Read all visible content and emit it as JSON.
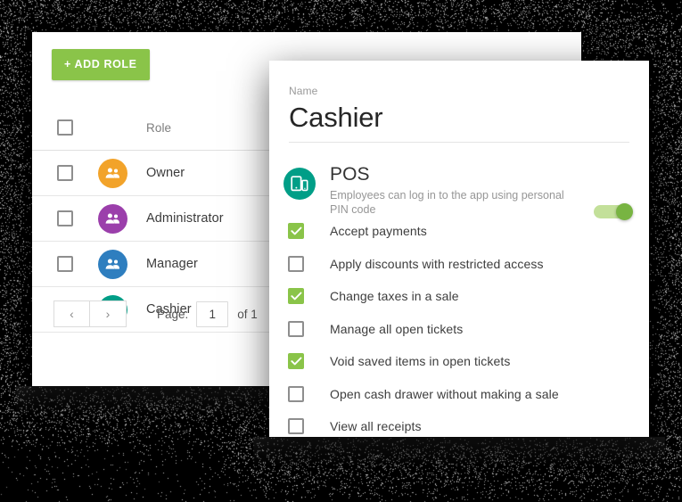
{
  "colors": {
    "accent_green": "#8ac449",
    "toggle_knob": "#78b442",
    "toggle_track": "#c3e09a",
    "teal": "#009e87",
    "backdrop": "#000000",
    "card": "#ffffff"
  },
  "roles_panel": {
    "add_role_label": "+ ADD ROLE",
    "header": {
      "select_all_checkbox": "",
      "role_column": "Role"
    },
    "rows": [
      {
        "name": "Owner",
        "avatar_icon": "people-icon",
        "avatar_color": "#f2a32a",
        "checked": false
      },
      {
        "name": "Administrator",
        "avatar_icon": "people-icon",
        "avatar_color": "#9b3fab",
        "checked": false
      },
      {
        "name": "Manager",
        "avatar_icon": "people-icon",
        "avatar_color": "#2e7ebf",
        "checked": false
      },
      {
        "name": "Cashier",
        "avatar_icon": "people-icon",
        "avatar_color": "#009e87",
        "checked": false
      }
    ],
    "pagination": {
      "prev_icon": "chevron-left-icon",
      "prev_label": "‹",
      "next_icon": "chevron-right-icon",
      "next_label": "›",
      "page_label": "Page:",
      "page_value": "1",
      "total_label": "of 1"
    }
  },
  "detail_panel": {
    "name_field": {
      "label": "Name",
      "value": "Cashier",
      "placeholder": "Name"
    },
    "pos_section": {
      "icon": "pos-devices-icon",
      "title": "POS",
      "description": "Employees can log in to the app using personal PIN code",
      "toggle_on": true
    },
    "permissions": [
      {
        "label": "Accept payments",
        "checked": true
      },
      {
        "label": "Apply discounts with restricted access",
        "checked": false
      },
      {
        "label": "Change taxes in a sale",
        "checked": true
      },
      {
        "label": "Manage all open tickets",
        "checked": false
      },
      {
        "label": "Void saved items in open tickets",
        "checked": true
      },
      {
        "label": "Open cash drawer without making a sale",
        "checked": false
      },
      {
        "label": "View all receipts",
        "checked": false
      }
    ]
  }
}
